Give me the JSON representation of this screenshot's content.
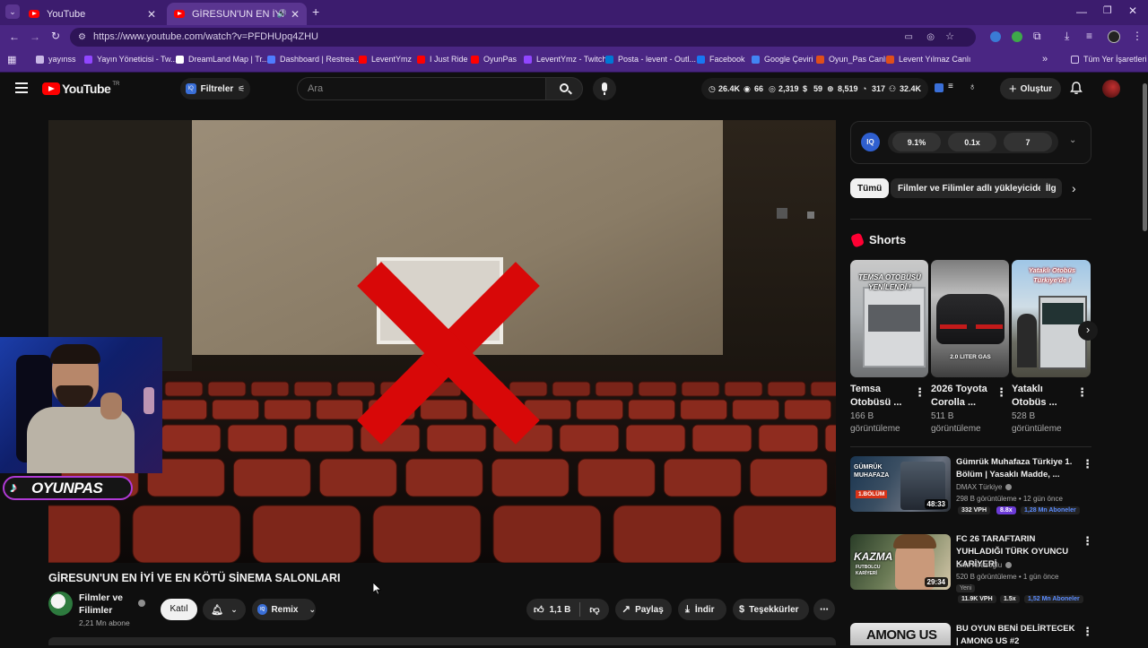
{
  "browser": {
    "tabs": [
      {
        "title": "YouTube"
      },
      {
        "title": "GİRESUN'UN EN İYİ VE EN"
      }
    ],
    "url": "https://www.youtube.com/watch?v=PFDHUpq4ZHU",
    "bookmarks": [
      {
        "label": "yayınss",
        "color": "#c9b8e6"
      },
      {
        "label": "Yayın Yöneticisi - Tw...",
        "color": "#9146ff"
      },
      {
        "label": "DreamLand Map | Tr...",
        "color": "#ffffff"
      },
      {
        "label": "Dashboard | Restrea...",
        "color": "#4f7cff"
      },
      {
        "label": "LeventYmz",
        "color": "#ff0000"
      },
      {
        "label": "I Just Ride",
        "color": "#ff0000"
      },
      {
        "label": "OyunPas",
        "color": "#ff0000"
      },
      {
        "label": "LeventYmz - Twitch",
        "color": "#9146ff"
      },
      {
        "label": "Posta - levent - Outl...",
        "color": "#0078d4"
      },
      {
        "label": "Facebook",
        "color": "#1877f2"
      },
      {
        "label": "Google Çeviri",
        "color": "#4285f4"
      },
      {
        "label": "Oyun_Pas Canlı",
        "color": "#e04f1a"
      },
      {
        "label": "Levent Yılmaz Canlı",
        "color": "#e04f1a"
      }
    ],
    "all_bookmarks_label": "Tüm Yer İşaretleri"
  },
  "header": {
    "logo_text": "YouTube",
    "logo_sup": "TR",
    "filters_label": "Filtreler",
    "search_placeholder": "Ara",
    "stats": [
      "26.4K",
      "66",
      "2,319",
      "59",
      "8,519",
      "317",
      "32.4K"
    ],
    "create_label": "Oluştur"
  },
  "iq_panel": {
    "badge": "IQ",
    "values": [
      "9.1%",
      "0.1x",
      "7"
    ]
  },
  "chips": [
    "Tümü",
    "Filmler ve Filimler adlı yükleyiciden",
    "İlg"
  ],
  "shorts": {
    "title": "Shorts",
    "items": [
      {
        "title": "Temsa Otobüsü ...",
        "views": "166 B görüntüleme",
        "overlay": "TEMSA OTOBÜSÜ YENİLENDİ !"
      },
      {
        "title": "2026 Toyota Corolla ...",
        "views": "511 B görüntüleme",
        "overlay": "2.0 LITER GAS"
      },
      {
        "title": "Yataklı Otobüs ...",
        "views": "528 B görüntüleme",
        "overlay": "Yataklı Otobüs Türkiye'de !"
      }
    ]
  },
  "recommendations": [
    {
      "title": "Gümrük Muhafaza Türkiye 1. Bölüm | Yasaklı Madde, ...",
      "channel": "DMAX Türkiye",
      "meta": "298 B görüntüleme • 12 gün önce",
      "vph": "332 VPH",
      "mult": "8.8x",
      "subs": "1,28 Mn Aboneler",
      "duration": "48:33",
      "thumb_text": "GÜMRÜK MUHAFAZA",
      "thumb_sub": "1.BÖLÜM"
    },
    {
      "title": "FC 26 TARAFTARIN YUHLADIĞI TÜRK OYUNCU KARİYERİ",
      "channel": "Enis Kirazoglu",
      "meta": "520 B görüntüleme • 1 gün önce",
      "badge": "Yeni",
      "vph": "11.9K VPH",
      "mult": "1.5x",
      "subs": "1,52 Mn Aboneler",
      "duration": "29:34",
      "thumb_text": "KAZMA",
      "thumb_sub": "FUTBOLCU KARİYERİ"
    },
    {
      "title": "BU OYUN BENİ DELİRTECEK | AMONG US #2",
      "thumb_text": "AMONG US"
    }
  ],
  "video": {
    "title": "GİRESUN'UN EN İYİ VE EN KÖTÜ SİNEMA SALONLARI",
    "channel": "Filmler ve Filimler",
    "subscribers": "2,21 Mn abone",
    "join_label": "Katıl",
    "remix_label": "Remix",
    "likes": "1,1 B",
    "share_label": "Paylaş",
    "download_label": "İndir",
    "thanks_label": "Teşekkürler",
    "webcam_brand": "OYUNPAS"
  }
}
